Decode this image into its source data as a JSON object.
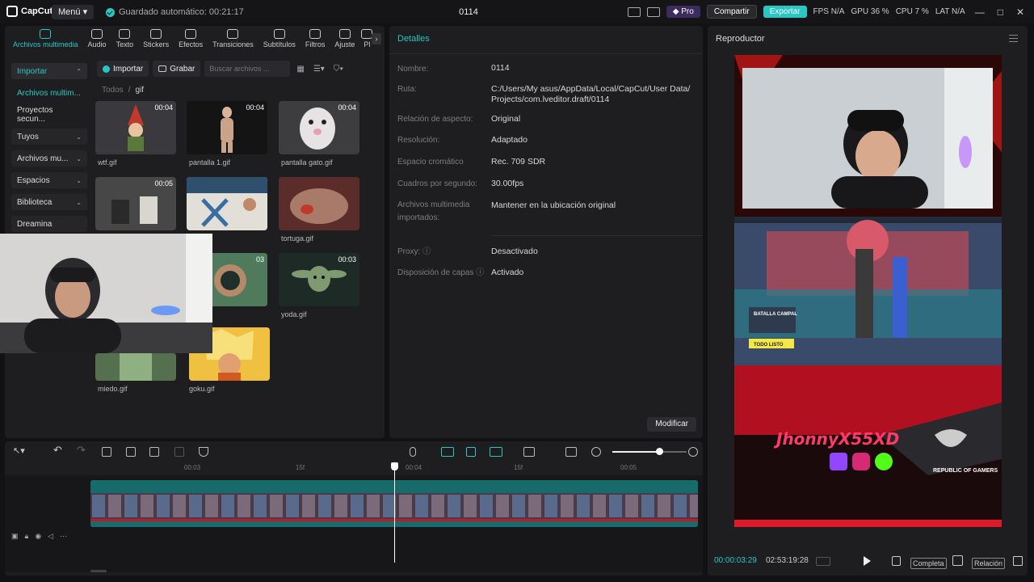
{
  "app": {
    "name": "CapCut",
    "menu_label": "Menú",
    "autosave": "Guardado automático: 00:21:17",
    "project_title": "0114"
  },
  "topbar": {
    "pro": "Pro",
    "share": "Compartir",
    "export": "Exportar",
    "stats": [
      "FPS N/A",
      "GPU 36 %",
      "CPU 7 %",
      "LAT N/A"
    ]
  },
  "tools": [
    {
      "label": "Archivos multimedia",
      "icon": "media-icon"
    },
    {
      "label": "Audio",
      "icon": "audio-icon"
    },
    {
      "label": "Texto",
      "icon": "text-icon"
    },
    {
      "label": "Stickers",
      "icon": "sticker-icon"
    },
    {
      "label": "Efectos",
      "icon": "effects-icon"
    },
    {
      "label": "Transiciones",
      "icon": "transition-icon"
    },
    {
      "label": "Subtítulos",
      "icon": "subtitle-icon"
    },
    {
      "label": "Filtros",
      "icon": "filter-icon"
    },
    {
      "label": "Ajuste",
      "icon": "adjust-icon"
    },
    {
      "label": "Pl",
      "icon": "plugin-icon"
    }
  ],
  "sidebar": {
    "items": [
      {
        "label": "Importar"
      },
      {
        "label": "Archivos multim..."
      },
      {
        "label": "Proyectos secun..."
      },
      {
        "label": "Tuyos"
      },
      {
        "label": "Archivos mu..."
      },
      {
        "label": "Espacios"
      },
      {
        "label": "Biblioteca"
      },
      {
        "label": "Dreamina"
      }
    ]
  },
  "media_toolbar": {
    "import": "Importar",
    "record": "Grabar",
    "search_placeholder": "Buscar archivos ..."
  },
  "breadcrumb": {
    "root": "Todos",
    "folder": "gif"
  },
  "media": [
    {
      "name": "wtf.gif",
      "dur": "00:04"
    },
    {
      "name": "pantalla 1.gif",
      "dur": "00:04"
    },
    {
      "name": "pantalla gato.gif",
      "dur": "00:04"
    },
    {
      "name": "",
      "dur": "00:05"
    },
    {
      "name": "ello bello.webp",
      "dur": ""
    },
    {
      "name": "tortuga.gif",
      "dur": ""
    },
    {
      "name": "",
      "dur": "03"
    },
    {
      "name": "yoda.gif",
      "dur": "00:03"
    },
    {
      "name": "miedo.gif",
      "dur": ""
    },
    {
      "name": "goku.gif",
      "dur": ""
    }
  ],
  "details": {
    "title": "Detalles",
    "rows": [
      {
        "label": "Nombre:",
        "value": "0114"
      },
      {
        "label": "Ruta:",
        "value": "C:/Users/My asus/AppData/Local/CapCut/User Data/ Projects/com.lveditor.draft/0114"
      },
      {
        "label": "Relación de aspecto:",
        "value": "Original"
      },
      {
        "label": "Resolución:",
        "value": "Adaptado"
      },
      {
        "label": "Espacio cromático",
        "value": "Rec. 709 SDR"
      },
      {
        "label": "Cuadros por segundo:",
        "value": "30.00fps"
      },
      {
        "label": "Archivos multimedia importados:",
        "value": "Mantener en la ubicación original"
      },
      {
        "label": "Proxy:",
        "value": "Desactivado"
      },
      {
        "label": "Disposición de capas",
        "value": "Activado"
      }
    ],
    "modify": "Modificar"
  },
  "player": {
    "title": "Reproductor",
    "time_current": "00:00:03:29",
    "time_total": "02:53:19:28",
    "full_label": "Completa",
    "ratio_label": "Relación",
    "overlay_name": "JhonnyX55XD",
    "brand": "REPUBLIC OF GAMERS",
    "game_labels": {
      "mode": "BATALLA CAMPAL",
      "ready": "TODO LISTO"
    }
  },
  "timeline": {
    "ruler": [
      "00:03",
      "15f",
      "00:04",
      "15f",
      "00:05"
    ],
    "zoom_level": 0.63
  },
  "colors": {
    "accent": "#29c7c4",
    "panel": "#1e1e21",
    "bg": "#121214"
  }
}
